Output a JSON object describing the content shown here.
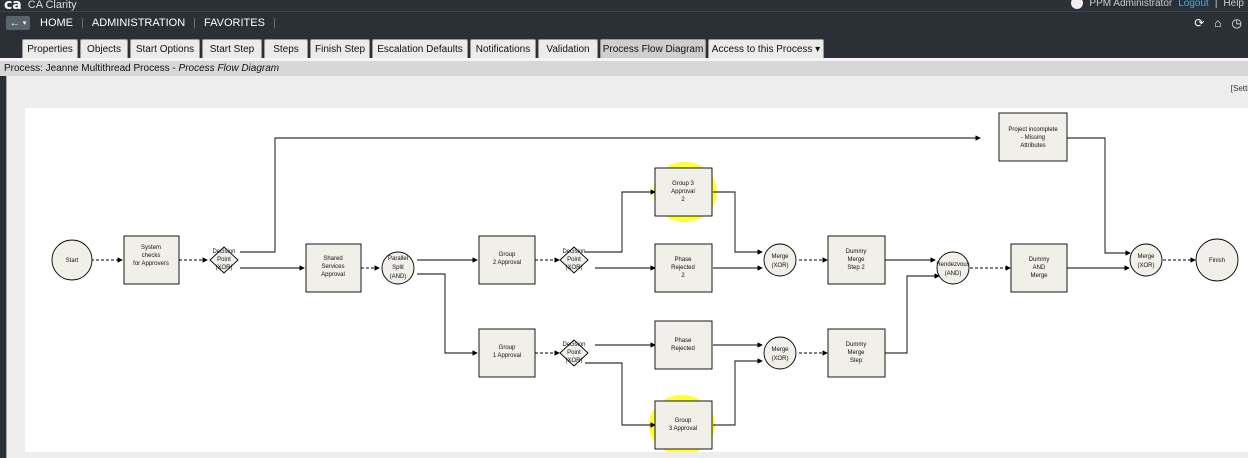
{
  "app": {
    "logo": "ca",
    "name": "CA Clarity",
    "user": "PPM Administrator",
    "logout": "Logout",
    "help": "Help"
  },
  "nav": {
    "back_label": "←",
    "home": "HOME",
    "administration": "ADMINISTRATION",
    "favorites": "FAVORITES"
  },
  "tabs": [
    {
      "label": "Properties"
    },
    {
      "label": "Objects"
    },
    {
      "label": "Start Options"
    },
    {
      "label": "Start Step"
    },
    {
      "label": "Steps"
    },
    {
      "label": "Finish Step"
    },
    {
      "label": "Escalation Defaults"
    },
    {
      "label": "Notifications"
    },
    {
      "label": "Validation"
    },
    {
      "label": "Process Flow Diagram"
    },
    {
      "label": "Access to this Process ▾"
    }
  ],
  "breadcrumb": {
    "prefix": "Process: Jeanne Multithread Process - ",
    "page": "Process Flow Diagram"
  },
  "settings_label": "[Setti",
  "diagram": {
    "start": "Start",
    "finish": "Finish",
    "system_checks": [
      "System",
      "checks",
      "for Approvers"
    ],
    "decision1": [
      "Decision",
      "Point",
      "(XOR)"
    ],
    "shared_services": [
      "Shared",
      "Services",
      "Approval"
    ],
    "parallel_split": [
      "Parallel",
      "Split",
      "(AND)"
    ],
    "group2": [
      "Group",
      "2 Approval"
    ],
    "decision2": [
      "Decision",
      "Point",
      "(XOR)"
    ],
    "group3_approval2": [
      "Group 3",
      "Approval",
      "2"
    ],
    "phase_rejected2": [
      "Phase",
      "Rejected",
      "2"
    ],
    "merge1": [
      "Merge",
      "(XOR)"
    ],
    "dummy_merge_step2": [
      "Dummy",
      "Merge",
      "Step 2"
    ],
    "rendezvous": [
      "Rendezvous",
      "(AND)"
    ],
    "dummy_and_merge": [
      "Dummy",
      "AND",
      "Merge"
    ],
    "merge_final": [
      "Merge",
      "(XOR)"
    ],
    "project_incomplete": [
      "Project incomplete",
      "- Missing",
      "Attributes"
    ],
    "group1": [
      "Group",
      "1 Approval"
    ],
    "decision3": [
      "Decision",
      "Point",
      "(XOR)"
    ],
    "phase_rejected": [
      "Phase",
      "Rejected"
    ],
    "merge2": [
      "Merge",
      "(XOR)"
    ],
    "dummy_merge_step": [
      "Dummy",
      "Merge",
      "Step"
    ],
    "group3_approval": [
      "Group",
      "3 Approval"
    ]
  }
}
